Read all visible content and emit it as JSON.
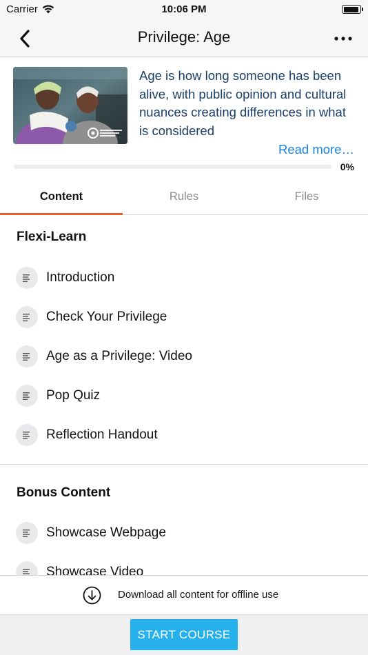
{
  "status_bar": {
    "carrier": "Carrier",
    "time": "10:06 PM",
    "battery_level": 0.95
  },
  "nav": {
    "title": "Privilege: Age",
    "back_icon": "chevron-left-icon",
    "more_icon": "more-horizontal-icon"
  },
  "course": {
    "description": "Age is how long someone has been alive, with public opinion and cultural nuances creating differences in what is considered",
    "read_more": "Read more…",
    "progress_percent": 0,
    "progress_label": "0%",
    "thumbnail_logo_text": "THE PRIVILEGE PROJECT"
  },
  "tabs": [
    {
      "label": "Content",
      "active": true
    },
    {
      "label": "Rules",
      "active": false
    },
    {
      "label": "Files",
      "active": false
    }
  ],
  "sections": [
    {
      "title": "Flexi-Learn",
      "items": [
        {
          "label": "Introduction",
          "icon": "text-lines-icon"
        },
        {
          "label": "Check Your Privilege",
          "icon": "text-lines-icon"
        },
        {
          "label": "Age as a Privilege: Video",
          "icon": "text-lines-icon"
        },
        {
          "label": "Pop Quiz",
          "icon": "text-lines-icon"
        },
        {
          "label": "Reflection Handout",
          "icon": "text-lines-icon"
        }
      ]
    },
    {
      "title": "Bonus Content",
      "items": [
        {
          "label": "Showcase Webpage",
          "icon": "text-lines-icon"
        },
        {
          "label": "Showcase Video",
          "icon": "text-lines-icon"
        }
      ]
    }
  ],
  "download": {
    "label": "Download all content for offline use",
    "icon": "download-circle-icon"
  },
  "start_button": {
    "label": "START COURSE"
  },
  "colors": {
    "accent": "#ef5a28",
    "primary_button": "#26b0ec",
    "link": "#1a83e0",
    "description_text": "#1a3f69"
  }
}
